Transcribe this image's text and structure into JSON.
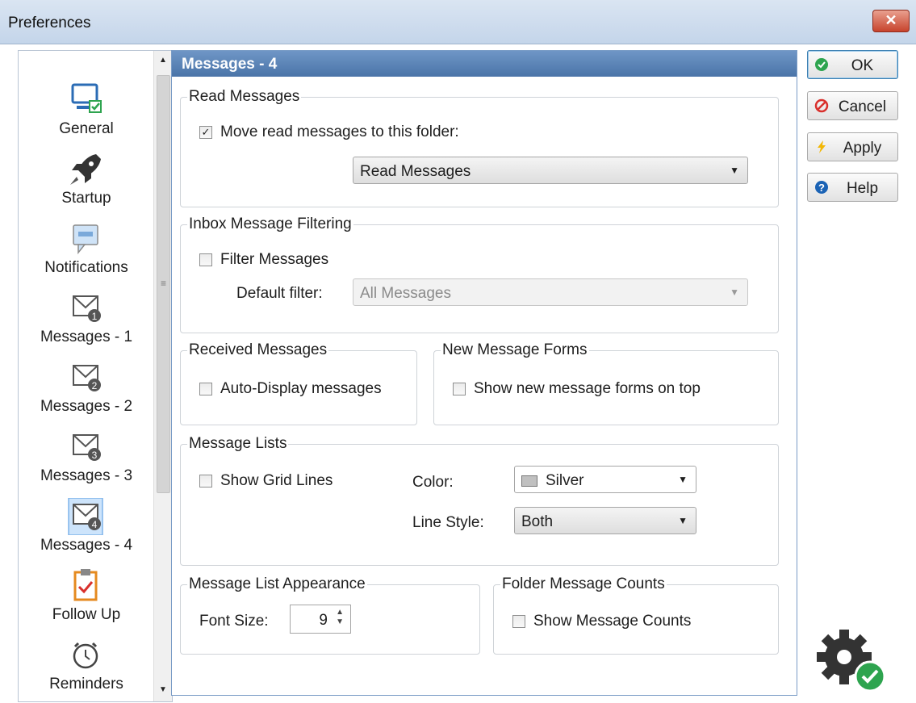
{
  "window": {
    "title": "Preferences",
    "close_label": "✕"
  },
  "sidebar": {
    "items": [
      {
        "label": "General",
        "icon": "monitor-check-icon"
      },
      {
        "label": "Startup",
        "icon": "rocket-icon"
      },
      {
        "label": "Notifications",
        "icon": "speech-bubble-icon"
      },
      {
        "label": "Messages - 1",
        "icon": "envelope-1-icon"
      },
      {
        "label": "Messages - 2",
        "icon": "envelope-2-icon"
      },
      {
        "label": "Messages - 3",
        "icon": "envelope-3-icon"
      },
      {
        "label": "Messages - 4",
        "icon": "envelope-4-icon",
        "selected": true
      },
      {
        "label": "Follow Up",
        "icon": "clipboard-check-icon"
      },
      {
        "label": "Reminders",
        "icon": "alarm-clock-icon"
      }
    ],
    "scroll_grip": "≡"
  },
  "panel": {
    "title": "Messages - 4",
    "read_messages": {
      "legend": "Read Messages",
      "move_label": "Move read messages to this folder:",
      "move_checked": true,
      "folder_value": "Read Messages"
    },
    "inbox_filtering": {
      "legend": "Inbox Message Filtering",
      "filter_label": "Filter Messages",
      "filter_checked": false,
      "default_filter_label": "Default filter:",
      "default_filter_value": "All Messages"
    },
    "received": {
      "legend": "Received Messages",
      "auto_display_label": "Auto-Display messages"
    },
    "new_forms": {
      "legend": "New Message Forms",
      "show_on_top_label": "Show new message forms on top"
    },
    "message_lists": {
      "legend": "Message Lists",
      "grid_lines_label": "Show Grid Lines",
      "color_label": "Color:",
      "color_value": "Silver",
      "line_style_label": "Line Style:",
      "line_style_value": "Both"
    },
    "list_appearance": {
      "legend": "Message List Appearance",
      "font_size_label": "Font Size:",
      "font_size_value": "9"
    },
    "folder_counts": {
      "legend": "Folder Message Counts",
      "show_counts_label": "Show Message Counts"
    }
  },
  "buttons": {
    "ok": "OK",
    "cancel": "Cancel",
    "apply": "Apply",
    "help": "Help"
  },
  "colors": {
    "header_blue": "#5a82b5",
    "ok_green": "#2ea44f",
    "cancel_red": "#d9302c",
    "help_blue": "#1b63b5",
    "apply_yellow": "#f2b705"
  }
}
